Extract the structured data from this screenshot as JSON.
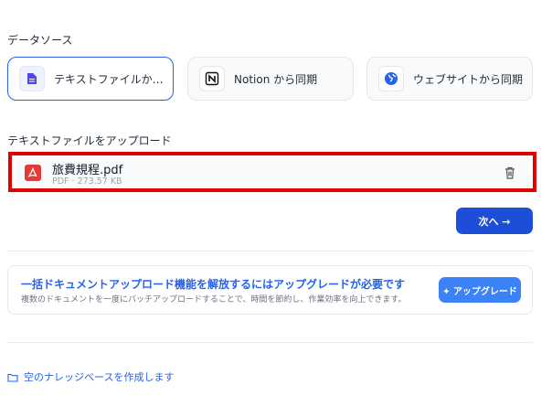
{
  "data_source": {
    "label": "データソース",
    "options": [
      {
        "label": "テキストファイルからイン...",
        "icon": "document-icon",
        "selected": true
      },
      {
        "label": "Notion から同期",
        "icon": "notion-icon",
        "selected": false
      },
      {
        "label": "ウェブサイトから同期",
        "icon": "globe-icon",
        "selected": false
      }
    ]
  },
  "upload": {
    "label": "テキストファイルをアップロード",
    "files": [
      {
        "name": "旅費規程.pdf",
        "meta": "PDF · 273.57 KB",
        "icon": "pdf-icon"
      }
    ]
  },
  "next_button": "次へ →",
  "upgrade": {
    "title": "一括ドキュメントアップロード機能を解放するにはアップグレードが必要です",
    "description": "複数のドキュメントを一度にバッチアップロードすることで、時間を節約し、作業効率を向上できます。",
    "button": "✦ アップグレード"
  },
  "empty_kb_link": "空のナレッジベースを作成します",
  "colors": {
    "accent": "#1d4ed8",
    "highlight": "#e00000",
    "pdf": "#e53935"
  }
}
